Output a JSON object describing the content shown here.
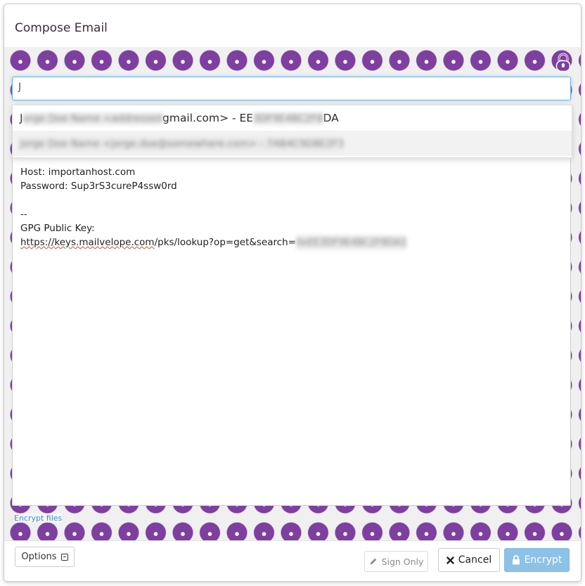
{
  "dialog": {
    "title": "Compose Email"
  },
  "recipient_input": {
    "value": "J"
  },
  "suggestions": [
    {
      "prefix": "J",
      "redacted_1": "orge Doe Name <addressed",
      "middle": "gmail.com> - EE",
      "redacted_2": "3DF9E4BC2F8",
      "suffix": "DA"
    },
    {
      "redacted": "Jorge Doe Name <jorge.doe@somewhere.com> - 7AB4C9D8E2F3"
    }
  ],
  "message": {
    "lines": [
      "Host: importanhost.com",
      "Password: Sup3rS3cureP4ssw0rd",
      "",
      "--",
      "GPG Public Key:"
    ],
    "link_prefix": "https://",
    "link_domain": "keys.mailvelope.com",
    "link_path": "/pks/lookup?op=get&search=",
    "link_redacted": "0xEE3DF9E4BC2F8DA1"
  },
  "footer": {
    "encrypt_files_label": "Encrypt files",
    "options_label": "Options",
    "sign_only_label": "Sign Only",
    "cancel_label": "Cancel",
    "encrypt_label": "Encrypt"
  },
  "colors": {
    "pattern_purple": "#7e3fa0",
    "encrypt_button": "#8ec1e6",
    "focus_border": "#66afe9"
  },
  "icons": {
    "options": "collapse-box-icon",
    "sign_only": "pencil-icon",
    "cancel": "x-icon",
    "encrypt": "lock-icon",
    "security_background": "padlock-icon"
  }
}
